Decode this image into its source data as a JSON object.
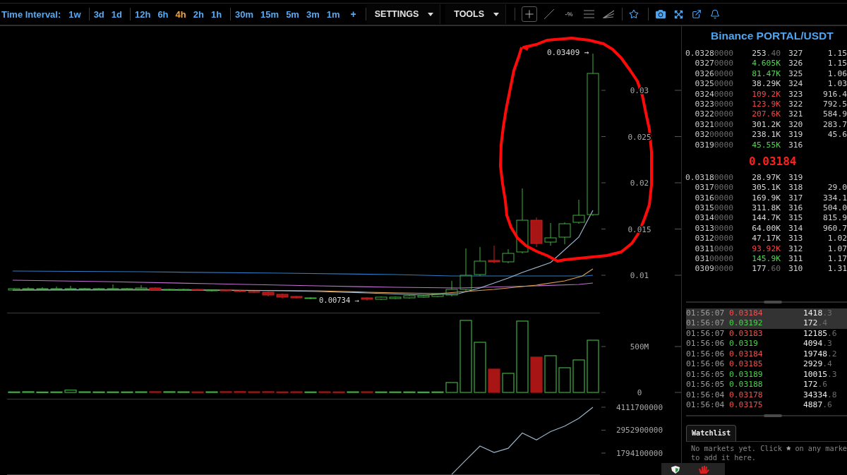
{
  "toolbar": {
    "label": "Time Interval:",
    "interval_groups": [
      [
        {
          "label": "1w",
          "selected": false
        }
      ],
      [
        {
          "label": "3d",
          "selected": false
        },
        {
          "label": "1d",
          "selected": false
        }
      ],
      [
        {
          "label": "12h",
          "selected": false
        },
        {
          "label": "6h",
          "selected": false
        },
        {
          "label": "4h",
          "selected": true
        },
        {
          "label": "2h",
          "selected": false
        },
        {
          "label": "1h",
          "selected": false
        }
      ],
      [
        {
          "label": "30m",
          "selected": false
        },
        {
          "label": "15m",
          "selected": false
        },
        {
          "label": "5m",
          "selected": false
        },
        {
          "label": "3m",
          "selected": false
        },
        {
          "label": "1m",
          "selected": false
        }
      ]
    ],
    "add_label": "+",
    "menus": [
      {
        "label": "SETTINGS"
      },
      {
        "label": "TOOLS"
      }
    ],
    "drawing_tools": [
      {
        "kind": "crosshair",
        "selected": true
      },
      {
        "kind": "line",
        "selected": false
      },
      {
        "kind": "percent",
        "label": "-%",
        "selected": false
      },
      {
        "kind": "levels",
        "selected": false
      },
      {
        "kind": "fan",
        "selected": false
      }
    ]
  },
  "chart": {
    "price_axis": [
      "0.03",
      "0.025",
      "0.02",
      "0.015",
      "0.01"
    ],
    "high_label": "0.03409 →",
    "low_label": "0.00734 →",
    "volume": {
      "chart_data": {
        "type": "bar",
        "stacked": true,
        "ylim": [
          0,
          865000000
        ],
        "yticks": [
          {
            "value": 0,
            "label": "0"
          },
          {
            "value": 500000000,
            "label": "500M"
          }
        ],
        "series": [
          {
            "color": "#3fae3f",
            "values": [
              6000000,
              8000000,
              5000000,
              6000000,
              25000000,
              7000000,
              6000000,
              6000000,
              6000000,
              7000000,
              null,
              8000000,
              7000000,
              null,
              7000000,
              null,
              null,
              null,
              null,
              null,
              null,
              6000000,
              null,
              null,
              7000000,
              null,
              6000000,
              6000000,
              6000000,
              5000000,
              6000000,
              108000000,
              785000000,
              546000000,
              null,
              208000000,
              777000000,
              null,
              400000000,
              269000000,
              354000000,
              569000000
            ]
          },
          {
            "color": "#a81515",
            "values": [
              null,
              null,
              null,
              null,
              null,
              null,
              null,
              null,
              null,
              null,
              8000000,
              null,
              null,
              6000000,
              null,
              8000000,
              9000000,
              7000000,
              8000000,
              6000000,
              7000000,
              null,
              7000000,
              6000000,
              null,
              7000000,
              null,
              null,
              null,
              null,
              null,
              null,
              null,
              null,
              254000000,
              null,
              null,
              385000000,
              null,
              null,
              null,
              null
            ]
          }
        ]
      }
    },
    "indicator": {
      "chart_data": {
        "type": "line",
        "ylim": [
          706000000,
          4520000000
        ],
        "yticks": [
          {
            "value": 1794100000,
            "label": "1794100000"
          },
          {
            "value": 2952900000,
            "label": "2952900000"
          },
          {
            "value": 4111700000,
            "label": "4111700000"
          }
        ],
        "series": [
          {
            "color": "#9ab4c8",
            "values": [
              null,
              null,
              null,
              null,
              null,
              null,
              null,
              null,
              null,
              null,
              null,
              null,
              null,
              null,
              null,
              null,
              null,
              null,
              null,
              null,
              null,
              null,
              null,
              null,
              null,
              null,
              null,
              null,
              null,
              null,
              null,
              720000000,
              1440000000,
              2150000000,
              1830000000,
              2040000000,
              2810000000,
              2460000000,
              2880000000,
              3160000000,
              3550000000,
              4110000000
            ]
          }
        ]
      }
    }
  },
  "order_book": {
    "title": "Binance PORTAL/USDT",
    "asks": [
      {
        "price": "0.0328",
        "price_dim": "0000",
        "amount": "253",
        "amount_dim": ".40",
        "color": "#d6d6d6",
        "count": "327",
        "total": "1.15"
      },
      {
        "price": "0327",
        "price_dim": "0000",
        "amount": "4.605K",
        "color": "#5ccf5c",
        "count": "326",
        "total": "1.15"
      },
      {
        "price": "0326",
        "price_dim": "0000",
        "amount": "81.47K",
        "color": "#5ccf5c",
        "count": "325",
        "total": "1.06"
      },
      {
        "price": "0325",
        "price_dim": "0000",
        "amount": "38.29K",
        "color": "#d6d6d6",
        "count": "324",
        "total": "1.03"
      },
      {
        "price": "0324",
        "price_dim": "0000",
        "amount": "109.2K",
        "color": "#f04848",
        "count": "323",
        "total": "916.4"
      },
      {
        "price": "0323",
        "price_dim": "0000",
        "amount": "123.9K",
        "color": "#f04848",
        "count": "322",
        "total": "792.5"
      },
      {
        "price": "0322",
        "price_dim": "0000",
        "amount": "207.6K",
        "color": "#f04848",
        "count": "321",
        "total": "584.9"
      },
      {
        "price": "0321",
        "price_dim": "0000",
        "amount": "301.2K",
        "color": "#d6d6d6",
        "count": "320",
        "total": "283.7"
      },
      {
        "price": "032",
        "price_dim": "00000",
        "amount": "238.1K",
        "color": "#d6d6d6",
        "count": "319",
        "total": "45.6"
      },
      {
        "price": "0319",
        "price_dim": "0000",
        "amount": "45.55K",
        "color": "#5ccf5c",
        "count": "316"
      }
    ],
    "last_price": "0.03184",
    "bids": [
      {
        "price": "0.0318",
        "price_dim": "0000",
        "amount": "28.97K",
        "color": "#d6d6d6",
        "count": "319"
      },
      {
        "price": "0317",
        "price_dim": "0000",
        "amount": "305.1K",
        "color": "#d6d6d6",
        "count": "318",
        "total": "29.0"
      },
      {
        "price": "0316",
        "price_dim": "0000",
        "amount": "169.9K",
        "color": "#d6d6d6",
        "count": "317",
        "total": "334.1"
      },
      {
        "price": "0315",
        "price_dim": "0000",
        "amount": "311.8K",
        "color": "#d6d6d6",
        "count": "316",
        "total": "504.0"
      },
      {
        "price": "0314",
        "price_dim": "0000",
        "amount": "144.7K",
        "color": "#d6d6d6",
        "count": "315",
        "total": "815.9"
      },
      {
        "price": "0313",
        "price_dim": "0000",
        "amount": "64.00K",
        "color": "#d6d6d6",
        "count": "314",
        "total": "960.7"
      },
      {
        "price": "0312",
        "price_dim": "0000",
        "amount": "47.17K",
        "color": "#d6d6d6",
        "count": "313",
        "total": "1.02"
      },
      {
        "price": "0311",
        "price_dim": "0000",
        "amount": "93.92K",
        "color": "#f04848",
        "count": "312",
        "total": "1.07"
      },
      {
        "price": "031",
        "price_dim": "00000",
        "amount": "145.9K",
        "color": "#5ccf5c",
        "count": "311",
        "total": "1.17"
      },
      {
        "price": "0309",
        "price_dim": "0000",
        "amount": "177",
        "amount_dim": ".60",
        "color": "#d6d6d6",
        "count": "310",
        "total": "1.31"
      }
    ]
  },
  "trades": [
    {
      "time": "01:56:07",
      "price": "0.03184",
      "color": "#e35454",
      "size": "1418",
      "size_dim": ".3",
      "highlighted": true
    },
    {
      "time": "01:56:07",
      "price": "0.03192",
      "color": "#4cd04c",
      "size": "172",
      "size_dim": ".4",
      "highlighted": true
    },
    {
      "time": "01:56:07",
      "price": "0.03183",
      "color": "#e35454",
      "size": "12185",
      "size_dim": ".6",
      "highlighted": false
    },
    {
      "time": "01:56:06",
      "price": "0.0319",
      "color": "#4cd04c",
      "size": "4094",
      "size_dim": ".3",
      "highlighted": false
    },
    {
      "time": "01:56:06",
      "price": "0.03184",
      "color": "#e35454",
      "size": "19748",
      "size_dim": ".2",
      "highlighted": false
    },
    {
      "time": "01:56:06",
      "price": "0.03185",
      "color": "#e35454",
      "size": "2929",
      "size_dim": ".4",
      "highlighted": false
    },
    {
      "time": "01:56:05",
      "price": "0.03189",
      "color": "#4cd04c",
      "size": "10015",
      "size_dim": ".3",
      "highlighted": false
    },
    {
      "time": "01:56:05",
      "price": "0.03188",
      "color": "#4cd04c",
      "size": "172",
      "size_dim": ".6",
      "highlighted": false
    },
    {
      "time": "01:56:04",
      "price": "0.03178",
      "color": "#e35454",
      "size": "34334",
      "size_dim": ".8",
      "highlighted": false
    },
    {
      "time": "01:56:04",
      "price": "0.03175",
      "color": "#e35454",
      "size": "4887",
      "size_dim": ".6",
      "highlighted": false
    }
  ],
  "watchlist": {
    "tab": "Watchlist",
    "message": [
      "No markets yet. Click",
      "on any marke",
      "to add it here."
    ]
  }
}
